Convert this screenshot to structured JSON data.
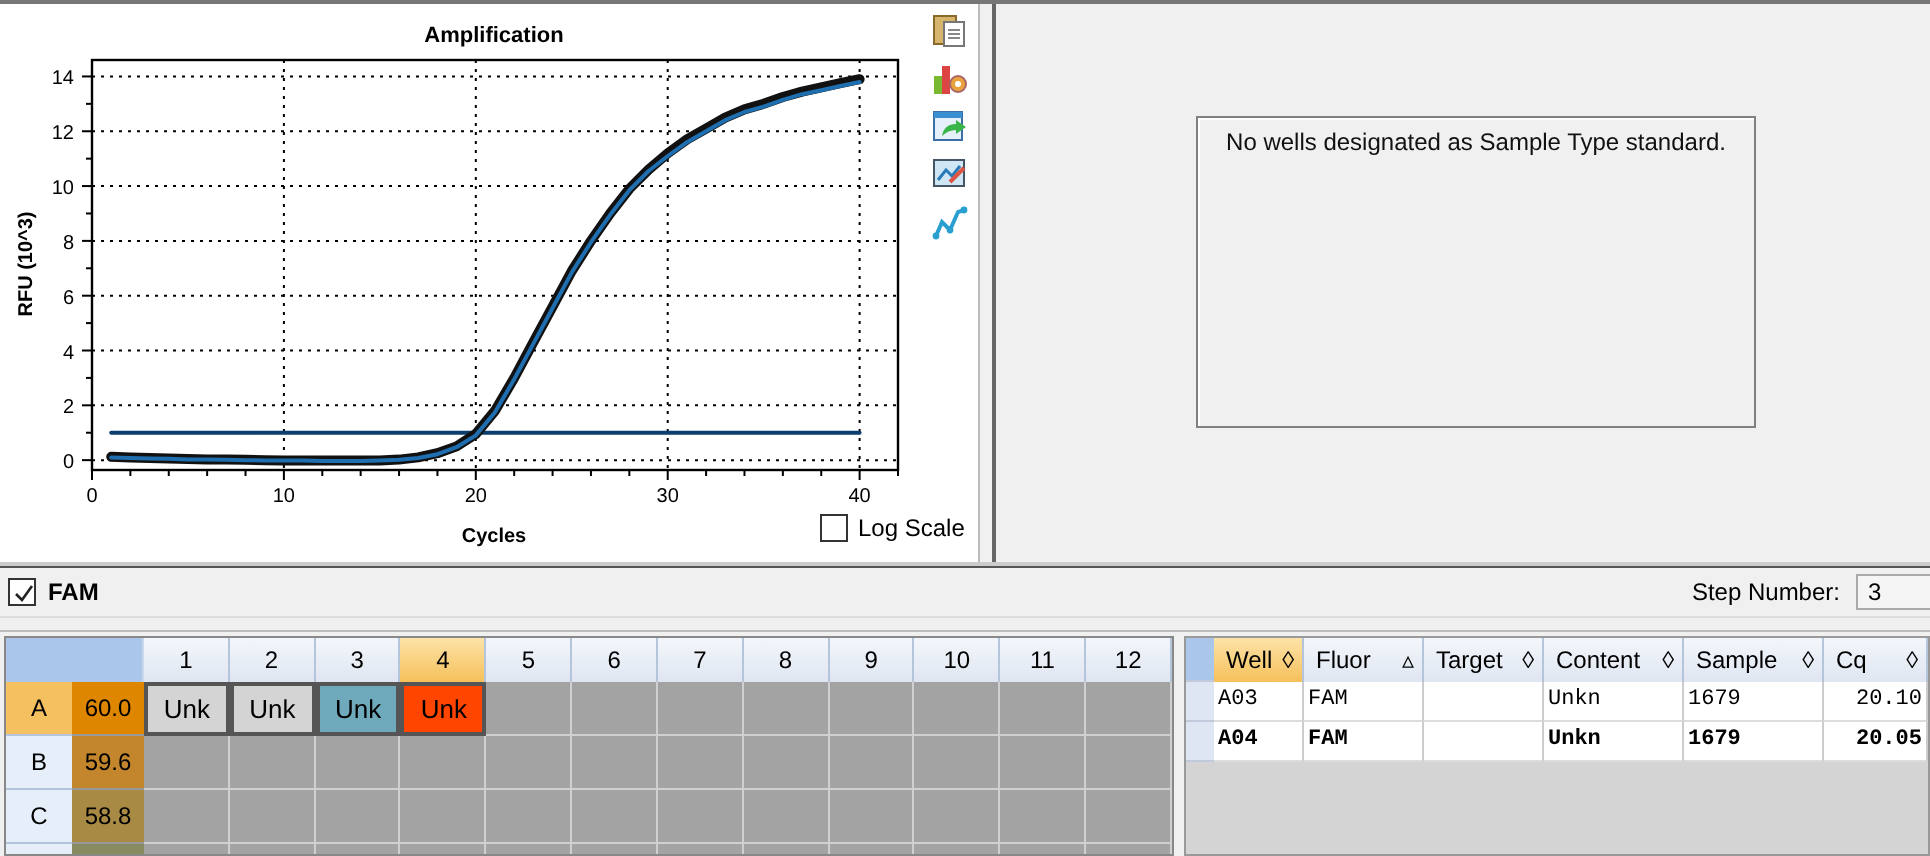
{
  "chart": {
    "log_scale": {
      "label": "Log Scale",
      "checked": false
    },
    "chart_data": {
      "type": "line",
      "title": "Amplification",
      "xlabel": "Cycles",
      "ylabel": "RFU (10^3)",
      "x": [
        1,
        2,
        3,
        4,
        5,
        6,
        7,
        8,
        9,
        10,
        11,
        12,
        13,
        14,
        15,
        16,
        17,
        18,
        19,
        20,
        21,
        22,
        23,
        24,
        25,
        26,
        27,
        28,
        29,
        30,
        31,
        32,
        33,
        34,
        35,
        36,
        37,
        38,
        39,
        40
      ],
      "series": [
        {
          "color": "#111111",
          "values": [
            0.12,
            0.1,
            0.08,
            0.06,
            0.04,
            0.03,
            0.02,
            0.01,
            0,
            -0.01,
            -0.02,
            -0.02,
            -0.02,
            -0.02,
            -0.01,
            0.02,
            0.1,
            0.25,
            0.5,
            0.95,
            1.8,
            3.0,
            4.3,
            5.6,
            6.9,
            8.0,
            9.0,
            9.9,
            10.6,
            11.2,
            11.7,
            12.1,
            12.5,
            12.8,
            13.0,
            13.25,
            13.45,
            13.6,
            13.75,
            13.9
          ]
        },
        {
          "color": "#1f6fb0",
          "values": [
            0.1,
            0.08,
            0.06,
            0.05,
            0.03,
            0.02,
            0.01,
            0,
            -0.01,
            -0.02,
            -0.02,
            -0.03,
            -0.03,
            -0.03,
            -0.02,
            0.01,
            0.08,
            0.22,
            0.47,
            0.9,
            1.75,
            2.95,
            4.25,
            5.55,
            6.85,
            7.95,
            8.95,
            9.85,
            10.55,
            11.1,
            11.6,
            12.0,
            12.4,
            12.7,
            12.9,
            13.15,
            13.35,
            13.5,
            13.65,
            13.8
          ]
        },
        {
          "color": "#0b3d6e",
          "values": [
            1,
            1,
            1,
            1,
            1,
            1,
            1,
            1,
            1,
            1,
            1,
            1,
            1,
            1,
            1,
            1,
            1,
            1,
            1,
            1,
            1,
            1,
            1,
            1,
            1,
            1,
            1,
            1,
            1,
            1,
            1,
            1,
            1,
            1,
            1,
            1,
            1,
            1,
            1,
            1
          ]
        }
      ],
      "xlim": [
        0,
        42
      ],
      "ylim": [
        -0.36,
        14.6
      ],
      "xticks": [
        0,
        10,
        20,
        30,
        40
      ],
      "yticks": [
        0,
        2,
        4,
        6,
        8,
        10,
        12,
        14
      ],
      "grid": true
    }
  },
  "standard_curve": {
    "message": "No wells designated as Sample Type standard."
  },
  "toolbar": {
    "fluor": {
      "label": "FAM",
      "checked": true
    },
    "step": {
      "label": "Step Number:",
      "value": "3"
    }
  },
  "plate": {
    "columns": [
      {
        "label": "1",
        "selected": false
      },
      {
        "label": "2",
        "selected": false
      },
      {
        "label": "3",
        "selected": false
      },
      {
        "label": "4",
        "selected": true
      },
      {
        "label": "5",
        "selected": false
      },
      {
        "label": "6",
        "selected": false
      },
      {
        "label": "7",
        "selected": false
      },
      {
        "label": "8",
        "selected": false
      },
      {
        "label": "9",
        "selected": false
      },
      {
        "label": "10",
        "selected": false
      },
      {
        "label": "11",
        "selected": false
      },
      {
        "label": "12",
        "selected": false
      }
    ],
    "rows": [
      {
        "label": "A",
        "selected": true,
        "temperature": "60.0",
        "color": "#df8600",
        "wells": [
          {
            "text": "Unk",
            "color": "#d4d4d4"
          },
          {
            "text": "Unk",
            "color": "#d4d4d4"
          },
          {
            "text": "Unk",
            "color": "#6fa9bc"
          },
          {
            "text": "Unk",
            "color": "#ff4500"
          }
        ]
      },
      {
        "label": "B",
        "selected": false,
        "temperature": "59.6",
        "color": "#c4862c"
      },
      {
        "label": "C",
        "selected": false,
        "temperature": "58.8",
        "color": "#a88a44"
      }
    ]
  },
  "table": {
    "columns": [
      {
        "label": "Well",
        "selected": true,
        "sort_mark": "◊"
      },
      {
        "label": "Fluor",
        "selected": false,
        "sort_mark": "▵"
      },
      {
        "label": "Target",
        "selected": false,
        "sort_mark": "◊"
      },
      {
        "label": "Content",
        "selected": false,
        "sort_mark": "◊"
      },
      {
        "label": "Sample",
        "selected": false,
        "sort_mark": "◊"
      },
      {
        "label": "Cq",
        "selected": false,
        "sort_mark": "◊"
      }
    ],
    "rows": [
      {
        "selected": false,
        "cells": [
          "A03",
          "FAM",
          "",
          "Unkn",
          "1679",
          "20.10"
        ]
      },
      {
        "selected": true,
        "cells": [
          "A04",
          "FAM",
          "",
          "Unkn",
          "1679",
          "20.05"
        ]
      }
    ]
  }
}
